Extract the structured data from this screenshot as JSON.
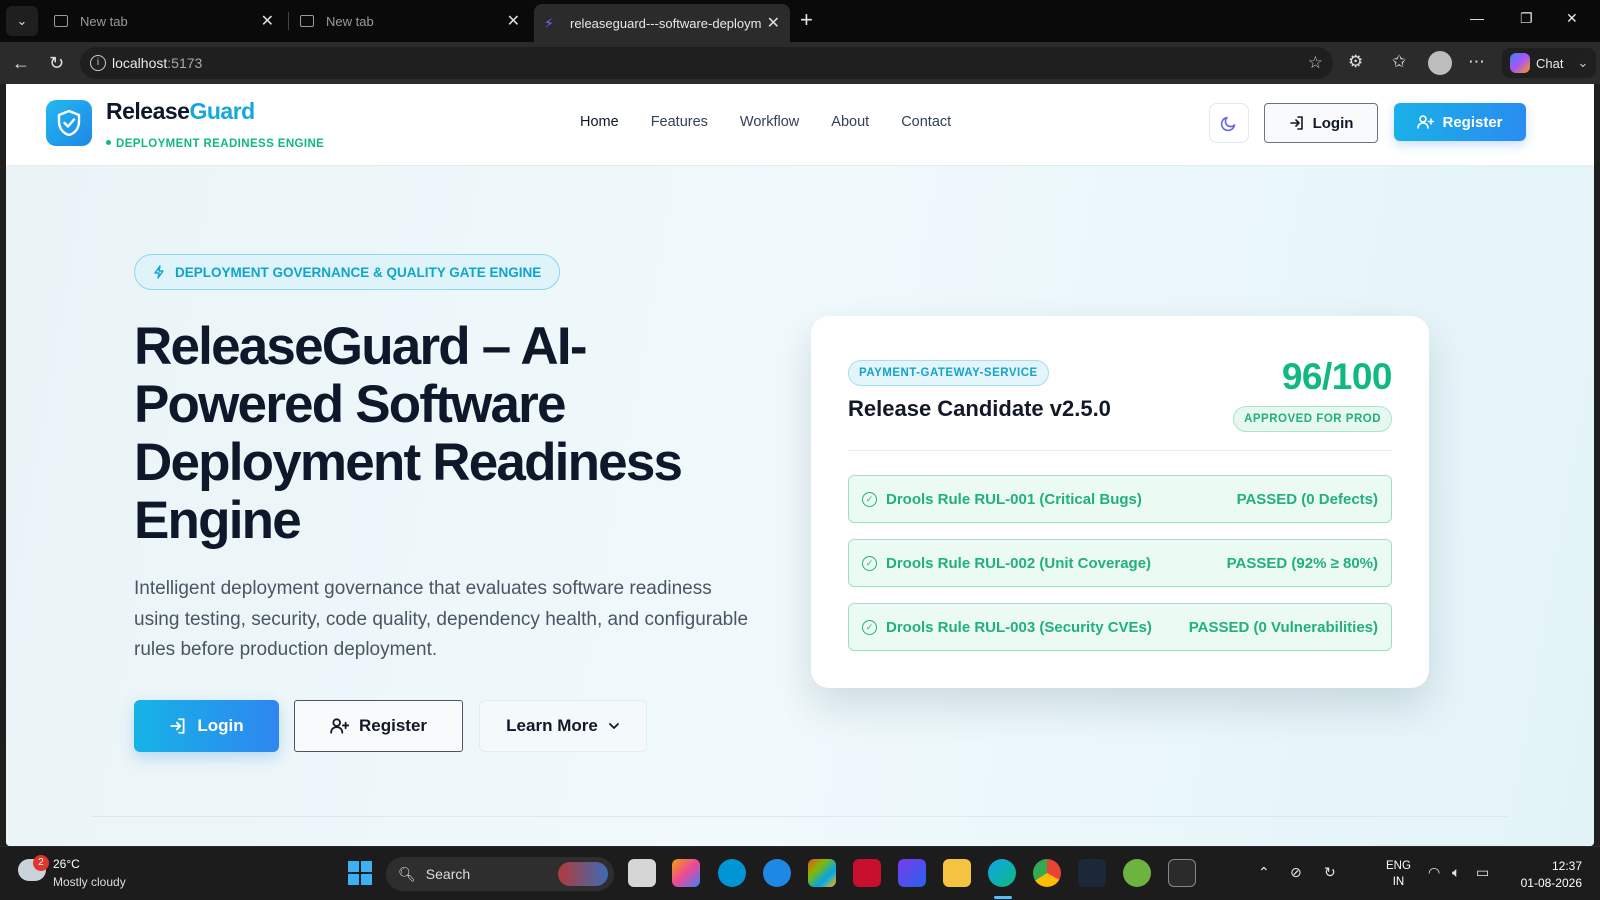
{
  "browser": {
    "tabs": [
      {
        "title": "New tab",
        "active": false
      },
      {
        "title": "New tab",
        "active": false
      },
      {
        "title": "releaseguard---software-deployme",
        "active": true
      }
    ],
    "url_host": "localhost",
    "url_port": ":5173",
    "chat_label": "Chat"
  },
  "header": {
    "brand_name_main": "Release",
    "brand_name_accent": "Guard",
    "brand_tagline": "DEPLOYMENT READINESS ENGINE",
    "nav": [
      "Home",
      "Features",
      "Workflow",
      "About",
      "Contact"
    ],
    "login_label": "Login",
    "register_label": "Register"
  },
  "hero": {
    "badge": "DEPLOYMENT GOVERNANCE & QUALITY GATE ENGINE",
    "title_lines": [
      "ReleaseGuard – AI-",
      "Powered Software",
      "Deployment Readiness",
      "Engine"
    ],
    "description": "Intelligent deployment governance that evaluates software readiness using testing, security, code quality, dependency health, and configurable rules before production deployment.",
    "login_label": "Login",
    "register_label": "Register",
    "learn_more_label": "Learn More"
  },
  "card": {
    "service": "PAYMENT-GATEWAY-SERVICE",
    "title": "Release Candidate v2.5.0",
    "score": "96/100",
    "status": "APPROVED FOR PROD",
    "rules": [
      {
        "name": "Drools Rule RUL-001 (Critical Bugs)",
        "result": "PASSED (0 Defects)"
      },
      {
        "name": "Drools Rule RUL-002 (Unit Coverage)",
        "result": "PASSED (92% ≥ 80%)"
      },
      {
        "name": "Drools Rule RUL-003 (Security CVEs)",
        "result": "PASSED (0 Vulnerabilities)"
      }
    ]
  },
  "taskbar": {
    "weather_badge": "2",
    "weather_temp": "26°C",
    "weather_desc": "Mostly cloudy",
    "search_label": "Search",
    "lang_line1": "ENG",
    "lang_line2": "IN",
    "time": "12:37",
    "date": "01-08-2026"
  },
  "colors": {
    "accent": "#14a9d8",
    "success": "#22b07c",
    "score": "#10b981",
    "title": "#0f172a"
  },
  "icons": {
    "brand": "shield-check-icon",
    "badge": "lightning-icon",
    "theme": "moon-icon",
    "login": "log-in-icon",
    "register": "user-plus-icon",
    "rule": "check-circle-icon"
  }
}
